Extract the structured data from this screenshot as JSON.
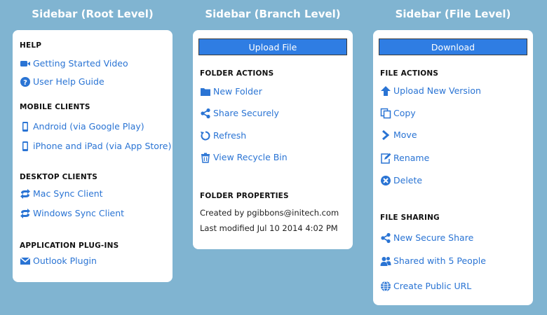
{
  "columns": {
    "root": {
      "title": "Sidebar (Root Level)"
    },
    "branch": {
      "title": "Sidebar (Branch Level)"
    },
    "file": {
      "title": "Sidebar (File Level)"
    }
  },
  "root": {
    "help": {
      "heading": "HELP",
      "video": "Getting Started Video",
      "guide": "User Help Guide"
    },
    "mobile": {
      "heading": "MOBILE CLIENTS",
      "android": "Android (via Google Play)",
      "iphone": "iPhone and iPad (via App Store)"
    },
    "desktop": {
      "heading": "DESKTOP CLIENTS",
      "mac": "Mac Sync Client",
      "windows": "Windows Sync Client"
    },
    "plugins": {
      "heading": "APPLICATION PLUG-INS",
      "outlook": "Outlook Plugin"
    }
  },
  "branch": {
    "button": "Upload File",
    "actions": {
      "heading": "FOLDER ACTIONS",
      "new_folder": "New Folder",
      "share": "Share Securely",
      "refresh": "Refresh",
      "recycle": "View Recycle Bin"
    },
    "properties": {
      "heading": "FOLDER PROPERTIES",
      "created_by": "Created by pgibbons@initech.com",
      "modified": "Last modified Jul 10 2014 4:02 PM"
    }
  },
  "file": {
    "button": "Download",
    "actions": {
      "heading": "FILE ACTIONS",
      "upload_version": "Upload New Version",
      "copy": "Copy",
      "move": "Move",
      "rename": "Rename",
      "delete": "Delete"
    },
    "sharing": {
      "heading": "FILE SHARING",
      "new_share": "New Secure Share",
      "shared_with": "Shared with 5 People",
      "public_url": "Create Public URL"
    }
  },
  "colors": {
    "background": "#80b4d1",
    "link": "#2a74d4",
    "button": "#2f7de3",
    "panel": "#ffffff"
  }
}
